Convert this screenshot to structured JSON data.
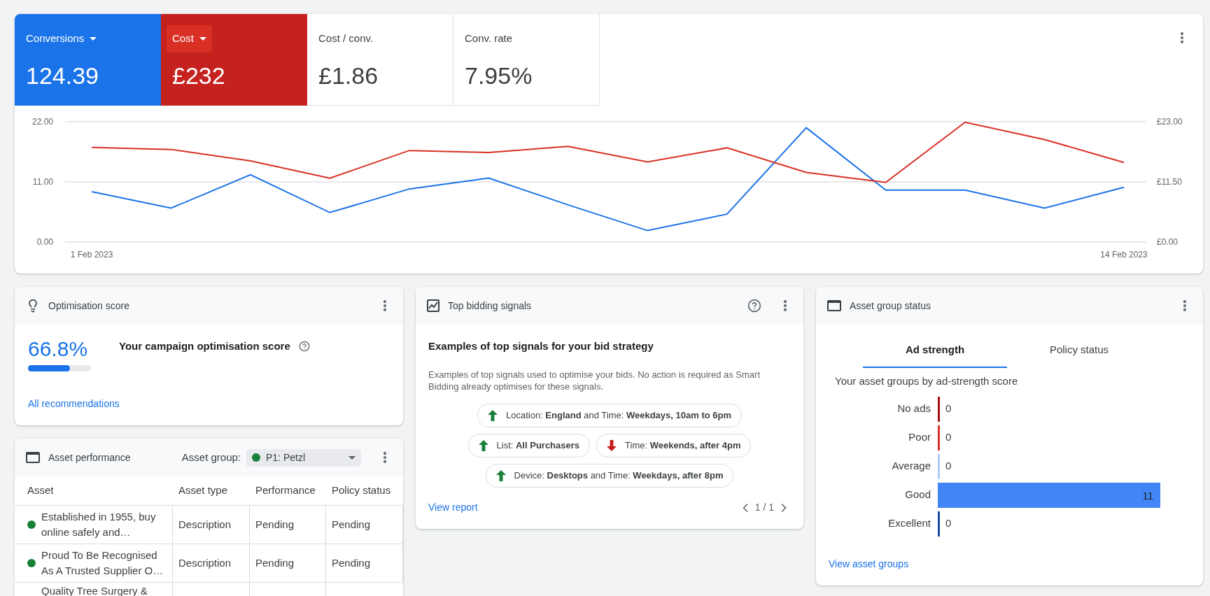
{
  "metrics": [
    {
      "label": "Conversions",
      "value": "124.39",
      "selected": true,
      "color": "#1a73e8",
      "focused": false
    },
    {
      "label": "Cost",
      "value": "£232",
      "selected": true,
      "color": "#c5221f",
      "focused": true
    },
    {
      "label": "Cost / conv.",
      "value": "£1.86",
      "selected": false,
      "focused": false
    },
    {
      "label": "Conv. rate",
      "value": "7.95%",
      "selected": false,
      "focused": false
    }
  ],
  "performance_chart": {
    "chart_data": {
      "type": "line",
      "categories": [
        "1 Feb 2023",
        null,
        null,
        null,
        null,
        null,
        null,
        null,
        null,
        null,
        null,
        null,
        null,
        "14 Feb 2023"
      ],
      "ylim": [
        0,
        22
      ],
      "yticks": [
        {
          "value": 0,
          "label": "0.00"
        },
        {
          "value": 11,
          "label": "11.00"
        },
        {
          "value": 22,
          "label": "22.00"
        }
      ],
      "y2lim": [
        0,
        23
      ],
      "y2ticks": [
        {
          "value": 0,
          "label": "£0.00"
        },
        {
          "value": 11.5,
          "label": "£11.50"
        },
        {
          "value": 23,
          "label": "£23.00"
        }
      ],
      "series": [
        {
          "color": "#1a73e8",
          "values": [
            9.2,
            6.2,
            12.3,
            5.4,
            9.7,
            11.7,
            6.8,
            2.1,
            5.1,
            20.9,
            9.5,
            9.5,
            6.2,
            10.0
          ]
        },
        {
          "color": "#d93025",
          "axis": "y2",
          "values": [
            18.1,
            17.7,
            15.5,
            12.2,
            17.5,
            17.1,
            18.3,
            15.3,
            18.0,
            13.3,
            11.4,
            22.9,
            19.6,
            15.2
          ]
        }
      ]
    }
  },
  "optimisation": {
    "title": "Optimisation score",
    "score": "66.8%",
    "level": 0.668,
    "heading": "Your campaign optimisation score",
    "link": "All recommendations"
  },
  "asset_performance": {
    "title": "Asset performance",
    "filter": {
      "label": "Asset group:",
      "value": "P1: Petzl",
      "color": "#188038"
    },
    "columns": [
      "Asset",
      "Asset type",
      "Performance",
      "Policy status"
    ],
    "rows": [
      {
        "asset": "Established in 1955, buy online safely and…",
        "color": "#188038",
        "type": "Description",
        "performance": "Pending",
        "policy": "Pending"
      },
      {
        "asset": "Proud To Be Recognised As A Trusted Supplier O…",
        "color": "#188038",
        "type": "Description",
        "performance": "Pending",
        "policy": "Pending"
      },
      {
        "asset": "Quality Tree Surgery &",
        "type": "",
        "performance": "",
        "policy": ""
      }
    ]
  },
  "bidding_signals": {
    "title": "Top bidding signals",
    "heading": "Examples of top signals for your bid strategy",
    "description": "Examples of top signals used to optimise your bids. No action is required as Smart Bidding already optimises for these signals.",
    "rows": [
      [
        {
          "text": "Location: **England** and Time: **Weekdays, 10am to 6pm**",
          "kind": "up"
        }
      ],
      [
        {
          "text": "List: **All Purchasers**",
          "kind": "up"
        },
        {
          "text": "Time: **Weekends, after 4pm**",
          "kind": "down"
        }
      ],
      [
        {
          "text": "Device: **Desktops** and Time: **Weekdays, after 8pm**",
          "kind": "up"
        }
      ]
    ],
    "link": "View report",
    "pager": "1 / 1"
  },
  "asset_group_status": {
    "title": "Asset group status",
    "tabs": [
      {
        "label": "Ad strength",
        "selected": true
      },
      {
        "label": "Policy status",
        "selected": false
      }
    ],
    "subtitle": "Your asset groups by ad-strength score",
    "bars": [
      {
        "label": "No ads",
        "value": "0",
        "kind": "empty",
        "color": "#a50e0e"
      },
      {
        "label": "Poor",
        "value": "0",
        "kind": "empty",
        "color": "#d93025"
      },
      {
        "label": "Average",
        "value": "0",
        "kind": "empty",
        "color": "#aecbfa"
      },
      {
        "label": "Good",
        "value": "11",
        "kind": "full",
        "color": "#4285f4"
      },
      {
        "label": "Excellent",
        "value": "0",
        "kind": "empty",
        "color": "#174ea6"
      }
    ],
    "link": "View asset groups"
  }
}
